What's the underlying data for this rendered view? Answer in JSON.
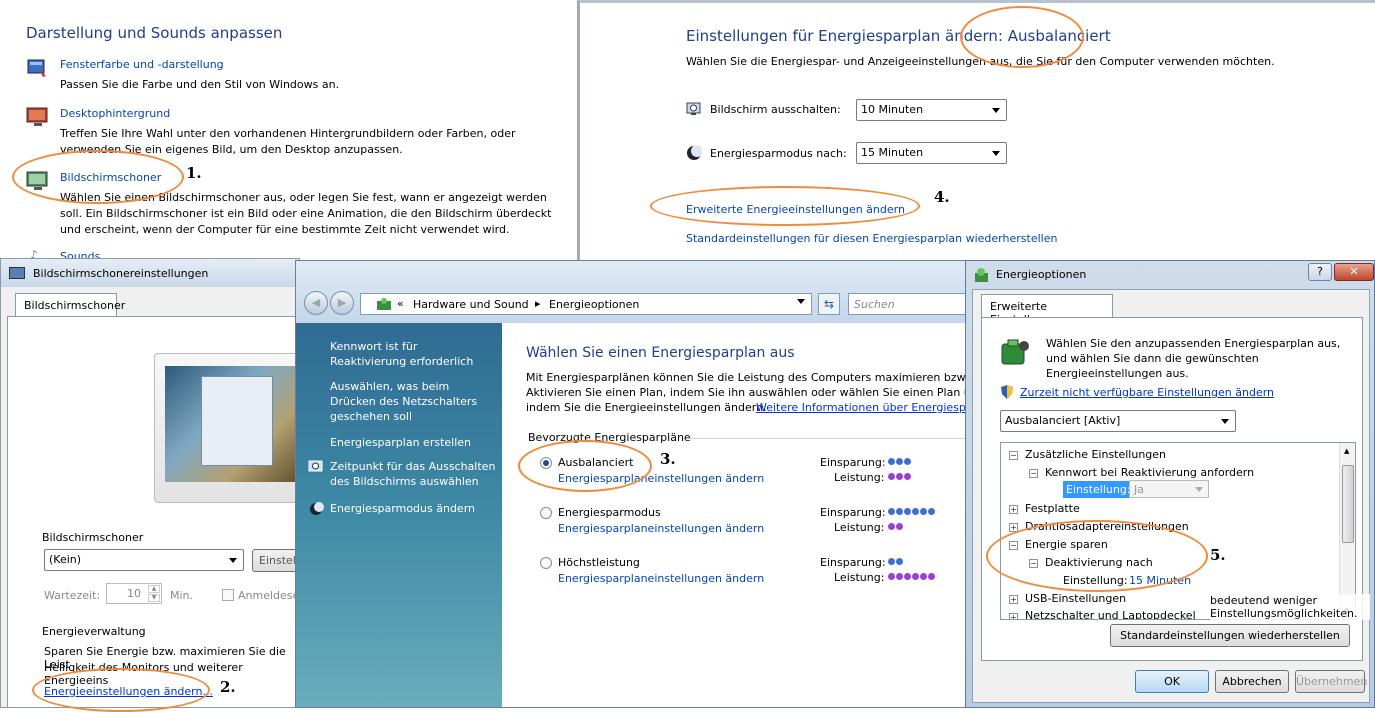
{
  "appearance": {
    "title": "Darstellung und Sounds anpassen",
    "items": [
      {
        "label": "Fensterfarbe und -darstellung",
        "desc": "Passen Sie die Farbe und den Stil von Windows an."
      },
      {
        "label": "Desktophintergrund",
        "desc": "Treffen Sie Ihre Wahl unter den vorhandenen Hintergrundbildern oder Farben, oder verwenden Sie ein eigenes Bild, um den Desktop anzupassen."
      },
      {
        "label": "Bildschirmschoner",
        "desc": "Wählen Sie einen Bildschirmschoner aus, oder legen Sie fest, wann er angezeigt werden soll. Ein Bildschirmschoner ist ein Bild oder eine Animation, die den Bildschirm überdeckt und erscheint, wenn der Computer für eine bestimmte Zeit nicht verwendet wird."
      },
      {
        "label": "Sounds"
      }
    ]
  },
  "plan_edit": {
    "title": "Einstellungen für Energiesparplan ändern: Ausbalanciert",
    "subtitle": "Wählen Sie die Energiespar- und Anzeigeeinstellungen aus, die Sie für den Computer verwenden möchten.",
    "display_off_label": "Bildschirm ausschalten:",
    "display_off_value": "10 Minuten",
    "sleep_label": "Energiesparmodus nach:",
    "sleep_value": "15 Minuten",
    "advanced_link": "Erweiterte Energieeinstellungen ändern",
    "restore_link": "Standardeinstellungen für diesen Energiesparplan wiederherstellen"
  },
  "screensaver": {
    "title": "Bildschirmschonereinstellungen",
    "tab": "Bildschirmschoner",
    "group": "Bildschirmschoner",
    "select": "(Kein)",
    "settings_btn": "Einstellu",
    "wait_label": "Wartezeit:",
    "wait_value": "10",
    "wait_unit": "Min.",
    "logon_label": "Anmeldese",
    "power_group": "Energieverwaltung",
    "power_text1": "Sparen Sie Energie bzw. maximieren Sie die Leist",
    "power_text2": "Helligkeit des Monitors und weiterer Energieeins",
    "power_link": "Energieeinstellungen ändern..."
  },
  "power_options": {
    "breadcrumb_root": "Hardware und Sound",
    "breadcrumb_page": "Energieoptionen",
    "search_placeholder": "Suchen",
    "sidebar": [
      "Kennwort ist für Reaktivierung erforderlich",
      "Auswählen, was beim Drücken des Netzschalters geschehen soll",
      "Energiesparplan erstellen",
      "Zeitpunkt für das Ausschalten des Bildschirms auswählen",
      "Energiesparmodus ändern"
    ],
    "heading": "Wählen Sie einen Energiesparplan aus",
    "intro1": "Mit Energiesparplänen können Sie die Leistung des Computers maximieren bzw. Ener",
    "intro2": "Aktivieren Sie einen Plan, indem Sie ihn auswählen oder wählen Sie einen Plan und p",
    "intro3": "indem Sie die Energieeinstellungen ändern.",
    "intro_link": "Weitere Informationen über Energiespa",
    "group": "Bevorzugte Energiesparpläne",
    "plans": [
      {
        "name": "Ausbalanciert",
        "link": "Energiesparplaneinstellungen ändern",
        "saving": 3,
        "performance": 3
      },
      {
        "name": "Energiesparmodus",
        "link": "Energiesparplaneinstellungen ändern",
        "saving": 6,
        "performance": 2
      },
      {
        "name": "Höchstleistung",
        "link": "Energiesparplaneinstellungen ändern",
        "saving": 2,
        "performance": 6
      }
    ],
    "saving_label": "Einsparung:",
    "performance_label": "Leistung:"
  },
  "energy_dialog": {
    "title": "Energieoptionen",
    "tab": "Erweiterte Einstellungen",
    "desc": "Wählen Sie den anzupassenden Energiesparplan aus, und wählen Sie dann die gewünschten Energieeinstellungen aus.",
    "unavailable_link": "Zurzeit nicht verfügbare Einstellungen ändern",
    "plan_select": "Ausbalanciert [Aktiv]",
    "tree": {
      "extra": "Zusätzliche Einstellungen",
      "password": "Kennwort bei Reaktivierung anfordern",
      "setting_label": "Einstellung:",
      "setting_value": "Ja",
      "harddisk": "Festplatte",
      "wireless": "Drahtlosadaptereinstellungen",
      "sleep": "Energie sparen",
      "sleep_after": "Deaktivierung nach",
      "sleep_value": "15 Minuten",
      "usb": "USB-Einstellungen",
      "power_button": "Netzschalter und Laptopdeckel"
    },
    "note": "bedeutend weniger Einstellungsmöglichkeiten.",
    "restore_btn": "Standardeinstellungen wiederherstellen",
    "ok": "OK",
    "cancel": "Abbrechen",
    "apply": "Übernehmen",
    "help": "?",
    "close": "✕"
  },
  "steps": [
    "1.",
    "2.",
    "3.",
    "4.",
    "5."
  ]
}
